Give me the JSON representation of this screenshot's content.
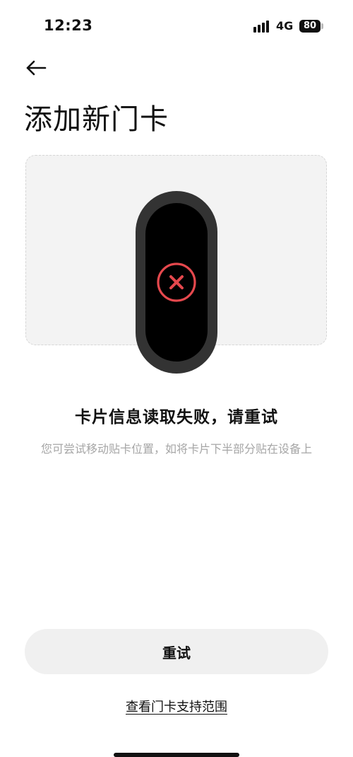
{
  "status_bar": {
    "time": "12:23",
    "network": "4G",
    "battery": "80",
    "icons": [
      "signal-icon",
      "battery-icon"
    ]
  },
  "header": {
    "back_icon": "back-arrow-icon",
    "title": "添加新门卡"
  },
  "illustration": {
    "device": "band-icon",
    "status_icon": "error-x-icon",
    "error_color": "#e5484d"
  },
  "message": {
    "title": "卡片信息读取失败，请重试",
    "subtitle": "您可尝试移动贴卡位置，如将卡片下半部分贴在设备上"
  },
  "actions": {
    "retry_label": "重试",
    "support_link_label": "查看门卡支持范围"
  }
}
